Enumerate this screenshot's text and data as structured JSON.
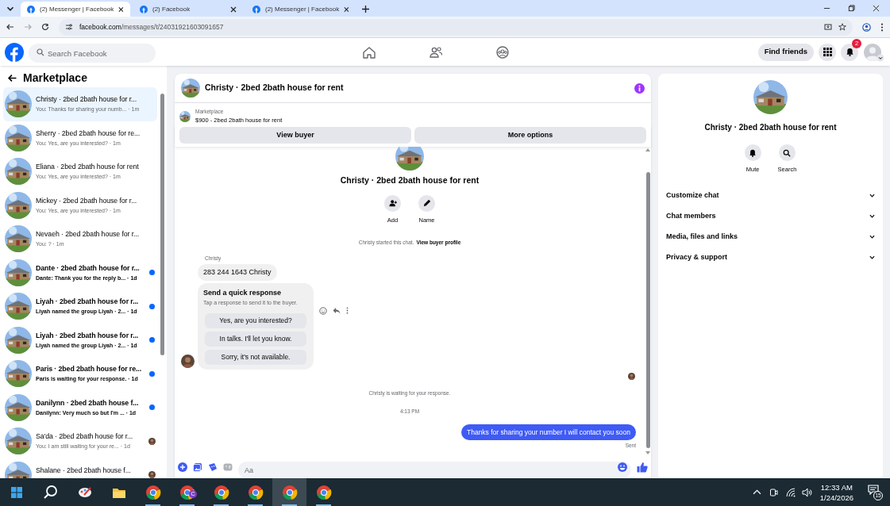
{
  "browser": {
    "tabs": [
      {
        "title": "(2) Messenger | Facebook",
        "selected": true
      },
      {
        "title": "(2) Facebook",
        "selected": false
      },
      {
        "title": "(2) Messenger | Facebook",
        "selected": false
      }
    ],
    "address": {
      "host": "facebook.com",
      "path": "/messages/t/24031921603091657"
    }
  },
  "header": {
    "search_placeholder": "Search Facebook",
    "nav": [
      {
        "kind": "home"
      },
      {
        "kind": "friends"
      },
      {
        "kind": "groups"
      }
    ],
    "find_friends": "Find friends",
    "notifications_badge": "2"
  },
  "sidebar": {
    "title": "Marketplace",
    "items": [
      {
        "title": "Christy · 2bed 2bath house for r...",
        "preview": "You: Thanks for sharing your numb... · 1m",
        "selected": true,
        "unread": false,
        "seen": false
      },
      {
        "title": "Sherry · 2bed 2bath house for re...",
        "preview": "You: Yes, are you interested? · 1m",
        "selected": false,
        "unread": false,
        "seen": false
      },
      {
        "title": "Eliana · 2bed 2bath house for rent",
        "preview": "You: Yes, are you interested? · 1m",
        "selected": false,
        "unread": false,
        "seen": false
      },
      {
        "title": "Mickey · 2bed 2bath house for r...",
        "preview": "You: Yes, are you interested? · 1m",
        "selected": false,
        "unread": false,
        "seen": false
      },
      {
        "title": "Nevaeh · 2bed 2bath house for r...",
        "preview": "You: ? · 1m",
        "selected": false,
        "unread": false,
        "seen": false
      },
      {
        "title": "Dante · 2bed 2bath house for r...",
        "preview": "Dante: Thank you for the reply b... · 1d",
        "selected": false,
        "unread": true,
        "seen": false
      },
      {
        "title": "Liyah · 2bed 2bath house for r...",
        "preview": "Liyah named the group Liyah · 2... · 1d",
        "selected": false,
        "unread": true,
        "seen": false
      },
      {
        "title": "Liyah · 2bed 2bath house for r...",
        "preview": "Liyah named the group Liyah · 2... · 1d",
        "selected": false,
        "unread": true,
        "seen": false
      },
      {
        "title": "Paris · 2bed 2bath house for re...",
        "preview": "Paris is waiting for your response. · 1d",
        "selected": false,
        "unread": true,
        "seen": false
      },
      {
        "title": "Danilynn · 2bed 2bath house f...",
        "preview": "Danilynn: Very much so but I'm ... · 1d",
        "selected": false,
        "unread": true,
        "seen": false
      },
      {
        "title": "Sa'da · 2bed 2bath house for r...",
        "preview": "You: I am still waiting for your re... · 1d",
        "selected": false,
        "unread": false,
        "seen": true
      },
      {
        "title": "Shalane · 2bed 2bath house f...",
        "selected": false,
        "unread": false,
        "seen": true
      }
    ]
  },
  "chat": {
    "title": "Christy · 2bed 2bath house for rent",
    "listing": {
      "label": "Marketplace",
      "text": "$900 - 2bed 2bath house for rent"
    },
    "buttons": [
      "View buyer",
      "More options"
    ],
    "intro": {
      "title": "Christy · 2bed 2bath house for rent",
      "actions": [
        {
          "kind": "add",
          "label": "Add"
        },
        {
          "kind": "name",
          "label": "Name"
        }
      ],
      "notice": "Christy started this chat.",
      "link": "View buyer profile"
    },
    "sender": "Christy",
    "message": "283 244 1643 Christy",
    "quick": {
      "title": "Send a quick response",
      "subtitle": "Tap a response to send it to the buyer.",
      "options": [
        "Yes, are you interested?",
        "In talks. I'll let you know.",
        "Sorry, it's not available."
      ]
    },
    "waiting": "Christy is waiting for your response.",
    "time": "4:13 PM",
    "reply": "Thanks for sharing your number I will contact you soon",
    "reply_status": "Sent",
    "composer_placeholder": "Aa"
  },
  "info": {
    "title": "Christy · 2bed 2bath house for rent",
    "actions": [
      {
        "kind": "mute",
        "label": "Mute"
      },
      {
        "kind": "search",
        "label": "Search"
      }
    ],
    "sections": [
      "Customize chat",
      "Chat members",
      "Media, files and links",
      "Privacy & support"
    ]
  },
  "taskbar": {
    "apps": [
      {
        "kind": "search",
        "selected": false
      },
      {
        "kind": "paint",
        "selected": false
      },
      {
        "kind": "folder",
        "selected": false
      },
      {
        "kind": "chrome",
        "selected": false
      },
      {
        "kind": "chrome",
        "badge": "C",
        "selected": false
      },
      {
        "kind": "chrome",
        "selected": false
      },
      {
        "kind": "chrome",
        "selected": false
      },
      {
        "kind": "chrome",
        "selected": true
      },
      {
        "kind": "chrome",
        "selected": false
      }
    ],
    "time": "12:33 AM",
    "date": "1/24/2026",
    "notifications": "15"
  }
}
